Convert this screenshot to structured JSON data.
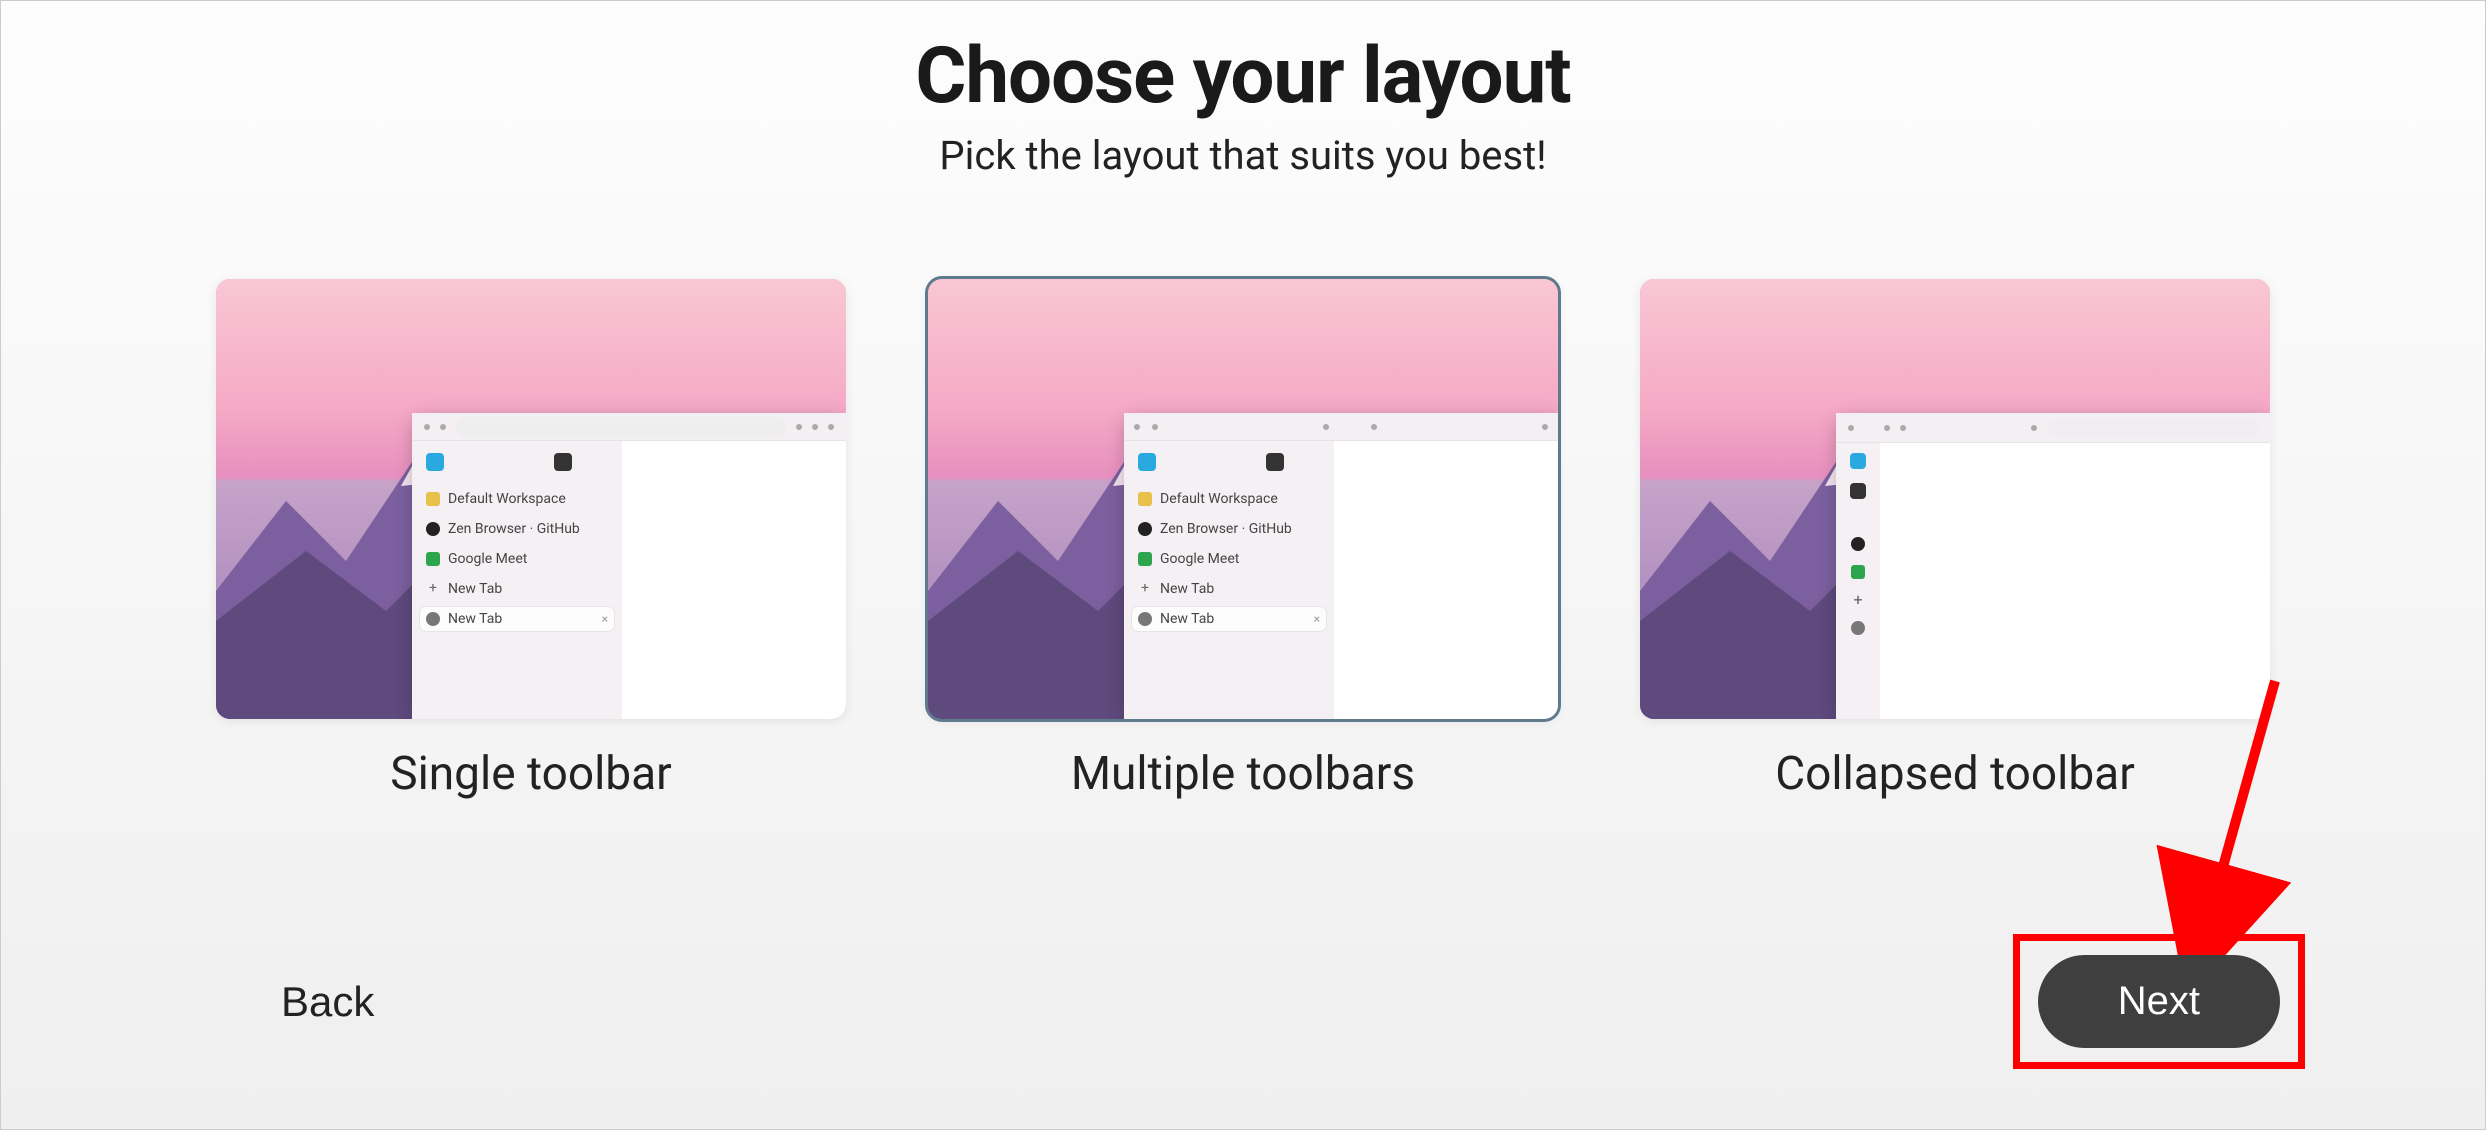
{
  "header": {
    "title": "Choose your layout",
    "subtitle": "Pick the layout that suits you best!"
  },
  "options": [
    {
      "id": "single",
      "label": "Single toolbar",
      "selected": false
    },
    {
      "id": "multiple",
      "label": "Multiple toolbars",
      "selected": true
    },
    {
      "id": "collapsed",
      "label": "Collapsed toolbar",
      "selected": false
    }
  ],
  "preview_sidebar_items": {
    "workspace": "Default Workspace",
    "zen_github": "Zen Browser · GitHub",
    "google_meet": "Google Meet",
    "new_tab": "New Tab"
  },
  "footer": {
    "back_label": "Back",
    "next_label": "Next"
  },
  "annotation": {
    "arrow_points_to": "next-button"
  }
}
